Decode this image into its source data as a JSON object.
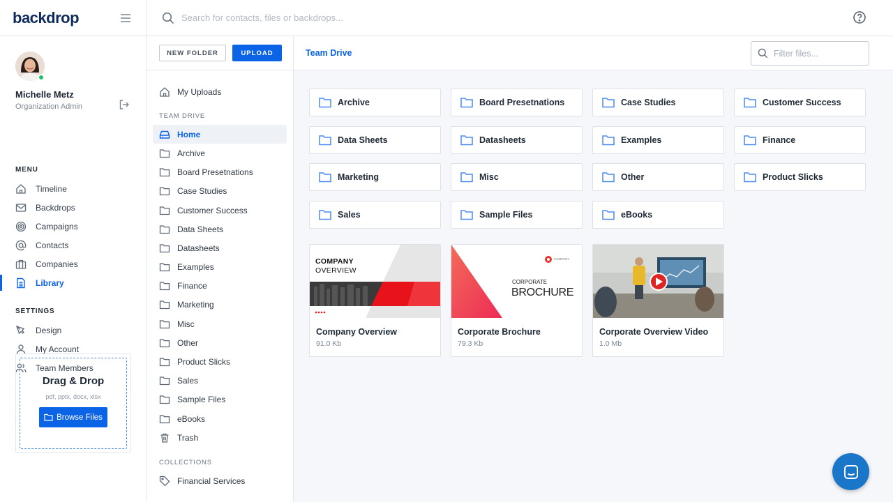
{
  "app": {
    "logo": "backdrop"
  },
  "search": {
    "placeholder": "Search for contacts, files or backdrops..."
  },
  "profile": {
    "name": "Michelle Metz",
    "role": "Organization Admin"
  },
  "menu": {
    "label": "MENU",
    "items": [
      {
        "label": "Timeline",
        "icon": "home-icon"
      },
      {
        "label": "Backdrops",
        "icon": "mail-icon"
      },
      {
        "label": "Campaigns",
        "icon": "target-icon"
      },
      {
        "label": "Contacts",
        "icon": "at-icon"
      },
      {
        "label": "Companies",
        "icon": "briefcase-icon"
      },
      {
        "label": "Library",
        "icon": "document-icon",
        "active": true
      }
    ]
  },
  "settings": {
    "label": "SETTINGS",
    "items": [
      {
        "label": "Design",
        "icon": "pen-tool-icon"
      },
      {
        "label": "My Account",
        "icon": "user-icon"
      },
      {
        "label": "Team Members",
        "icon": "users-icon"
      }
    ]
  },
  "dropzone": {
    "title": "Drag & Drop",
    "formats": "pdf, pptx, docx, xlsx",
    "button": "Browse Files"
  },
  "folder_panel": {
    "new_folder": "NEW FOLDER",
    "upload": "UPLOAD",
    "my_uploads": "My Uploads",
    "team_drive_label": "TEAM DRIVE",
    "tree": [
      "Home",
      "Archive",
      "Board Presetnations",
      "Case Studies",
      "Customer Success",
      "Data Sheets",
      "Datasheets",
      "Examples",
      "Finance",
      "Marketing",
      "Misc",
      "Other",
      "Product Slicks",
      "Sales",
      "Sample Files",
      "eBooks",
      "Trash"
    ],
    "collections_label": "COLLECTIONS",
    "collections": [
      "Financial Services"
    ]
  },
  "main": {
    "breadcrumb": "Team Drive",
    "filter_placeholder": "Filter files...",
    "folders": [
      "Archive",
      "Board Presetnations",
      "Case Studies",
      "Customer Success",
      "Data Sheets",
      "Datasheets",
      "Examples",
      "Finance",
      "Marketing",
      "Misc",
      "Other",
      "Product Slicks",
      "Sales",
      "Sample Files",
      "eBooks"
    ],
    "files": [
      {
        "name": "Company Overview",
        "size": "91.0 Kb",
        "thumb": {
          "line1": "COMPANY",
          "line2": "OVERVIEW"
        }
      },
      {
        "name": "Corporate Brochure",
        "size": "79.3 Kb",
        "thumb": {
          "brand": "COMPANY",
          "line1": "CORPORATE",
          "line2": "BROCHURE"
        }
      },
      {
        "name": "Corporate Overview Video",
        "size": "1.0 Mb"
      }
    ]
  },
  "colors": {
    "accent": "#0b63e6",
    "folder": "#4a8af0",
    "online": "#1fbf6b",
    "chat": "#1976c9"
  }
}
